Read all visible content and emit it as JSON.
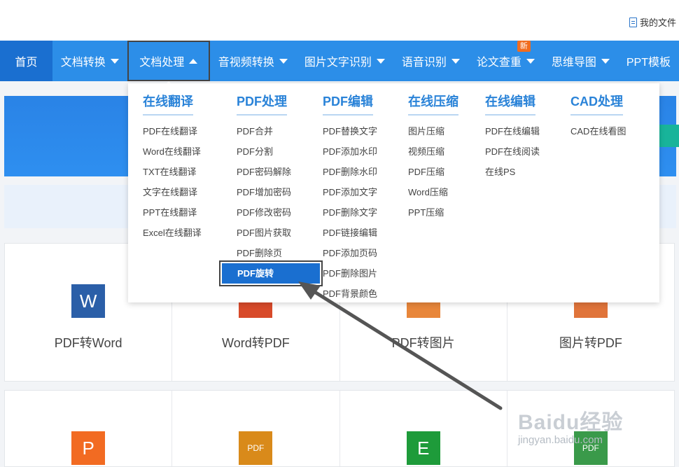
{
  "topbar": {
    "my_files": "我的文件"
  },
  "nav": {
    "items": [
      {
        "label": "首页"
      },
      {
        "label": "文档转换"
      },
      {
        "label": "文档处理"
      },
      {
        "label": "音视频转换"
      },
      {
        "label": "图片文字识别"
      },
      {
        "label": "语音识别"
      },
      {
        "label": "论文查重",
        "badge": "新"
      },
      {
        "label": "思维导图"
      },
      {
        "label": "PPT模板"
      }
    ]
  },
  "dropdown": {
    "columns": [
      {
        "title": "在线翻译",
        "items": [
          "PDF在线翻译",
          "Word在线翻译",
          "TXT在线翻译",
          "文字在线翻译",
          "PPT在线翻译",
          "Excel在线翻译"
        ]
      },
      {
        "title": "PDF处理",
        "items": [
          "PDF合并",
          "PDF分割",
          "PDF密码解除",
          "PDF增加密码",
          "PDF修改密码",
          "PDF图片获取",
          "PDF删除页",
          "PDF旋转"
        ]
      },
      {
        "title": "PDF编辑",
        "items": [
          "PDF替换文字",
          "PDF添加水印",
          "PDF删除水印",
          "PDF添加文字",
          "PDF删除文字",
          "PDF链接编辑",
          "PDF添加页码",
          "PDF删除图片",
          "PDF背景颜色"
        ]
      },
      {
        "title": "在线压缩",
        "items": [
          "图片压缩",
          "视频压缩",
          "PDF压缩",
          "Word压缩",
          "PPT压缩"
        ]
      },
      {
        "title": "在线编辑",
        "items": [
          "PDF在线编辑",
          "PDF在线阅读",
          "在线PS"
        ]
      },
      {
        "title": "CAD处理",
        "items": [
          "CAD在线看图"
        ]
      }
    ]
  },
  "tiles_row1": [
    {
      "label": "PDF转Word",
      "icon": "W"
    },
    {
      "label": "Word转PDF",
      "icon": ""
    },
    {
      "label": "PDF转图片",
      "icon": ""
    },
    {
      "label": "图片转PDF",
      "icon": ""
    }
  ],
  "tiles_row2": [
    {
      "icon": "P"
    },
    {
      "icon": "PDF"
    },
    {
      "icon": "E"
    },
    {
      "icon": "PDF"
    }
  ],
  "watermark": {
    "main": "Baidu经验",
    "sub": "jingyan.baidu.com"
  },
  "colors": {
    "nav": "#2c8ee8",
    "home": "#1a6fd0",
    "accent": "#2a83d8",
    "badge": "#f06c1f"
  }
}
